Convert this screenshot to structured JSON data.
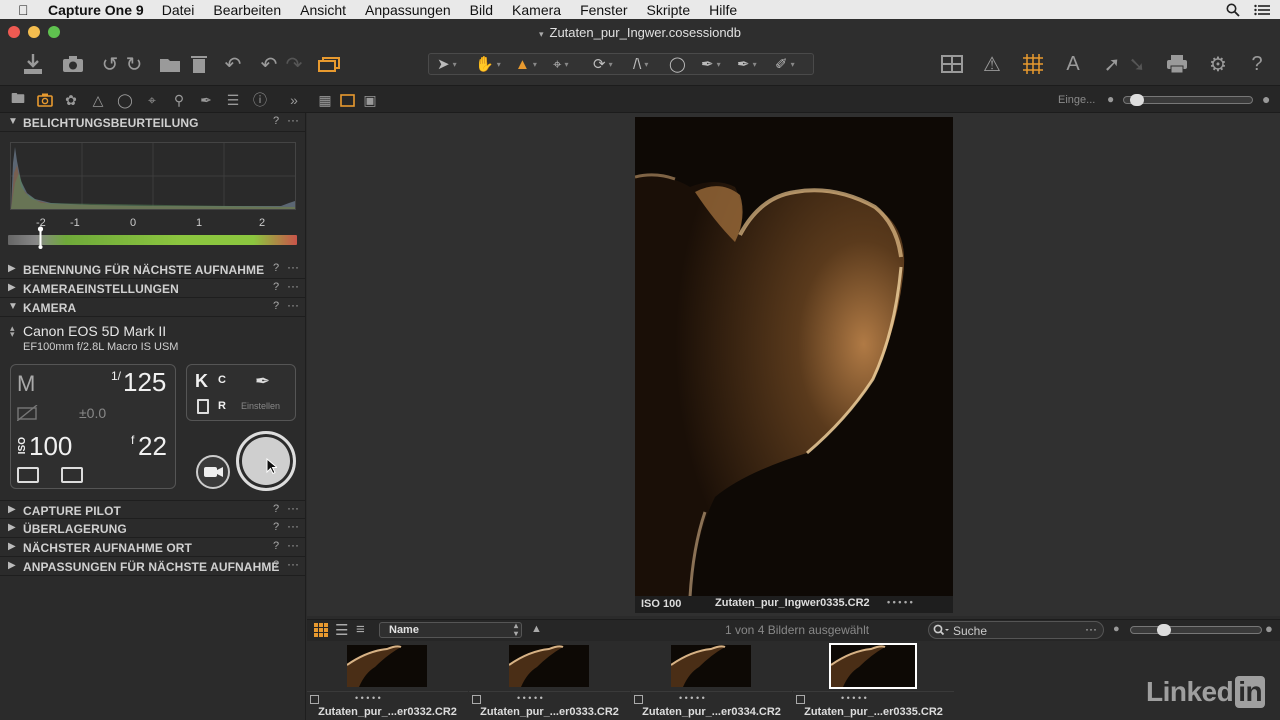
{
  "menubar": {
    "app_name": "Capture One 9",
    "items": [
      "Datei",
      "Bearbeiten",
      "Ansicht",
      "Anpassungen",
      "Bild",
      "Kamera",
      "Fenster",
      "Skripte",
      "Hilfe"
    ]
  },
  "window": {
    "title": "Zutaten_pur_Ingwer.cosessiondb"
  },
  "viewer_header": {
    "zoom_label": "Einge..."
  },
  "panel": {
    "sections": {
      "exposure": "BELICHTUNGSBEURTEILUNG",
      "naming": "BENENNUNG FÜR NÄCHSTE AUFNAHME",
      "camera_settings": "KAMERAEINSTELLUNGEN",
      "camera": "KAMERA",
      "capture_pilot": "CAPTURE PILOT",
      "overlay": "ÜBERLAGERUNG",
      "next_location": "NÄCHSTER AUFNAHME ORT",
      "next_adjustments": "ANPASSUNGEN FÜR NÄCHSTE AUFNAHME"
    },
    "help": "?",
    "more": "···",
    "ev_labels": [
      "-2",
      "-1",
      "0",
      "1",
      "2"
    ],
    "camera": {
      "model": "Canon EOS 5D Mark II",
      "lens": "EF100mm f/2.8L Macro IS USM",
      "mode": "M",
      "shutter_num": "1/",
      "shutter": "125",
      "exposure_comp": "±0.0",
      "iso_label": "ISO",
      "iso": "100",
      "aperture_f": "f",
      "aperture": "22",
      "k_label": "K",
      "c_label": "C",
      "r_label": "R",
      "adjust_label": "Einstellen"
    }
  },
  "viewer": {
    "iso_badge": "ISO 100",
    "filename": "Zutaten_pur_Ingwer0335.CR2",
    "dots": "• • • • •"
  },
  "browser": {
    "sort_label": "Name",
    "selection_status": "1 von 4 Bildern ausgewählt",
    "search_placeholder": "Suche",
    "thumbnails": [
      {
        "name": "Zutaten_pur_...er0332.CR2"
      },
      {
        "name": "Zutaten_pur_...er0333.CR2"
      },
      {
        "name": "Zutaten_pur_...er0334.CR2"
      },
      {
        "name": "Zutaten_pur_...er0335.CR2"
      }
    ],
    "thumb_dots": "• • • • •"
  },
  "watermark": {
    "text_a": "Linked",
    "text_b": "in"
  },
  "colors": {
    "accent": "#e89a2f",
    "background": "#2b2b2b"
  },
  "icons": {
    "toolbar_left": [
      "import-icon",
      "camera-icon",
      "rotate-left-icon",
      "rotate-right-icon",
      "folder-icon",
      "trash-icon",
      "undo-all-icon",
      "undo-icon",
      "redo-icon",
      "variants-icon"
    ],
    "toolbar_right": [
      "grid-icon",
      "warning-icon",
      "focus-grid-icon",
      "text-icon",
      "export-icon",
      "import-arrow-icon",
      "print-icon",
      "settings-icon",
      "help-icon"
    ]
  }
}
